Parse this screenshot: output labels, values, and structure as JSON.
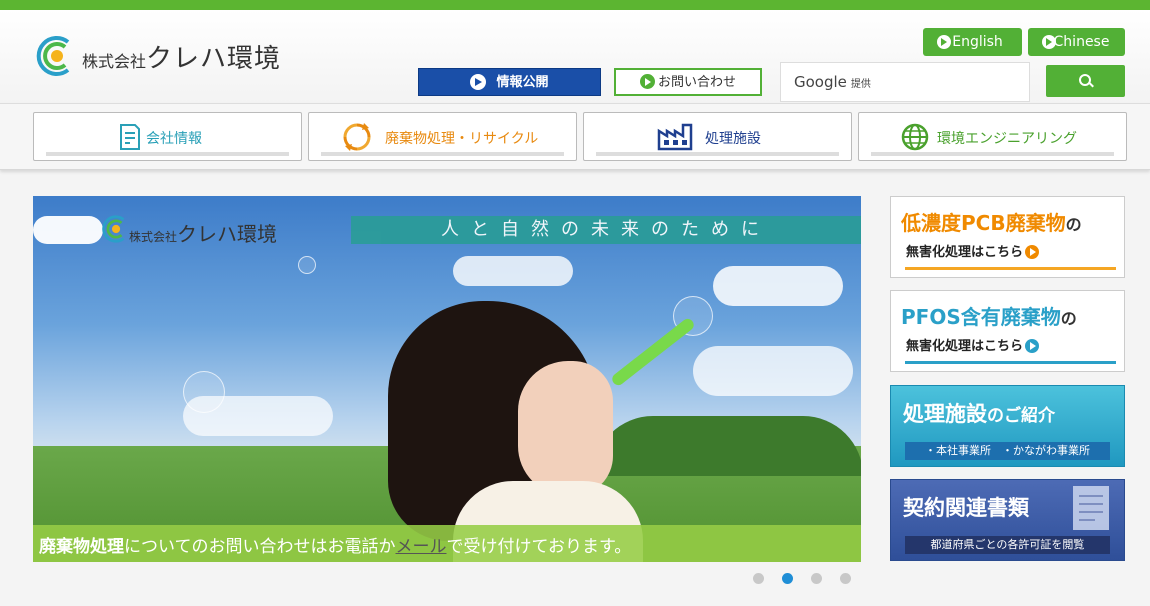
{
  "header": {
    "logo_text": "株式会社クレハ環境",
    "logo_prefix": "株式会社",
    "logo_name": "クレハ環境",
    "lang_english": "English",
    "lang_chinese": "Chinese",
    "disclosure_label": "情報公開",
    "contact_label": "お問い合わせ",
    "search_brand": "Google",
    "search_brand_sub": "提供",
    "search_value": ""
  },
  "nav": {
    "tabs": [
      {
        "label": "会社情報",
        "icon": "document-icon",
        "color": "#2aa0b7"
      },
      {
        "label": "廃棄物処理・リサイクル",
        "icon": "recycle-icon",
        "color": "#e88a10"
      },
      {
        "label": "処理施設",
        "icon": "factory-icon",
        "color": "#1f3f8f"
      },
      {
        "label": "環境エンジニアリング",
        "icon": "globe-icon",
        "color": "#4aa12d"
      }
    ]
  },
  "hero": {
    "logo_prefix": "株式会社",
    "logo_name": "クレハ環境",
    "tagline": "人と自然の未来のために",
    "caption_bold": "廃棄物処理",
    "caption_mid": "についてのお問い合わせはお電話か",
    "caption_link": "メール",
    "caption_end": "で受け付けております。",
    "slides_total": 4,
    "active_slide": 2
  },
  "banners": [
    {
      "title_main": "低濃度PCB廃棄物",
      "title_suffix": "の",
      "sub": "無害化処理はこちら",
      "accent": "#f5a623"
    },
    {
      "title_main": "PFOS含有廃棄物",
      "title_suffix": "の",
      "sub": "無害化処理はこちら",
      "accent": "#2aa0c8"
    },
    {
      "title_main": "処理施設",
      "title_suffix": "のご紹介",
      "strip": "・本社事業所　・かながわ事業所"
    },
    {
      "title_main": "契約関連書類",
      "strip": "都道府県ごとの各許可証を閲覧"
    }
  ],
  "colors": {
    "brand_green": "#52b036",
    "brand_blue": "#1a4fa8"
  }
}
